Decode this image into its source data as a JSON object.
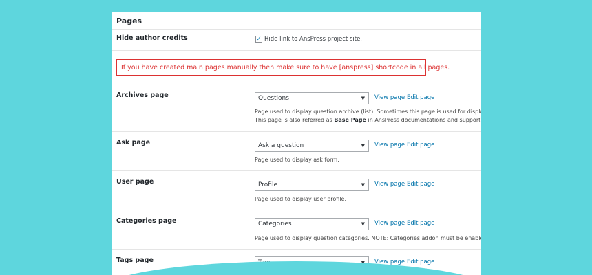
{
  "section": {
    "title": "Pages"
  },
  "hide_credits": {
    "label": "Hide author credits",
    "checkbox_label": "Hide link to AnsPress project site.",
    "checked": true
  },
  "notice": {
    "text": "If you have created main pages manually then make sure to have [anspress] shortcode in all pages."
  },
  "links": {
    "view": "View page",
    "edit": "Edit page"
  },
  "rows": [
    {
      "label": "Archives page",
      "selected": "Questions",
      "desc1": "Page used to display question archive (list). Sometimes this page is used for displaying",
      "desc2_pre": "This page is also referred as ",
      "desc2_bold": "Base Page",
      "desc2_post": " in AnsPress documentations and support forum"
    },
    {
      "label": "Ask page",
      "selected": "Ask a question",
      "desc1": "Page used to display ask form."
    },
    {
      "label": "User page",
      "selected": "Profile",
      "desc1": "Page used to display user profile."
    },
    {
      "label": "Categories page",
      "selected": "Categories",
      "desc1": "Page used to display question categories. NOTE: Categories addon must be enabled to"
    },
    {
      "label": "Tags page",
      "selected": "Tags"
    }
  ],
  "colors": {
    "background": "#5ed6dd",
    "accent": "#0073aa",
    "notice": "#dc3232"
  }
}
